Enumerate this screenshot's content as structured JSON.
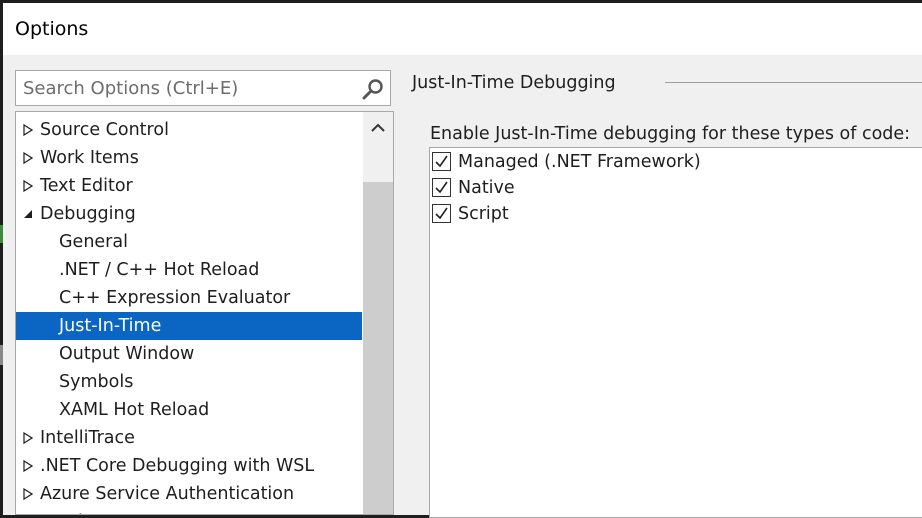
{
  "window": {
    "title": "Options"
  },
  "search": {
    "placeholder": "Search Options (Ctrl+E)"
  },
  "tree": {
    "items": [
      {
        "label": "Source Control",
        "expander": "collapsed",
        "level": 0
      },
      {
        "label": "Work Items",
        "expander": "collapsed",
        "level": 0
      },
      {
        "label": "Text Editor",
        "expander": "collapsed",
        "level": 0
      },
      {
        "label": "Debugging",
        "expander": "expanded",
        "level": 0
      },
      {
        "label": "General",
        "expander": "none",
        "level": 1
      },
      {
        "label": ".NET / C++ Hot Reload",
        "expander": "none",
        "level": 1
      },
      {
        "label": "C++ Expression Evaluator",
        "expander": "none",
        "level": 1
      },
      {
        "label": "Just-In-Time",
        "expander": "none",
        "level": 1,
        "selected": true
      },
      {
        "label": "Output Window",
        "expander": "none",
        "level": 1
      },
      {
        "label": "Symbols",
        "expander": "none",
        "level": 1
      },
      {
        "label": "XAML Hot Reload",
        "expander": "none",
        "level": 1
      },
      {
        "label": "IntelliTrace",
        "expander": "collapsed",
        "level": 0
      },
      {
        "label": ".NET Core Debugging with WSL",
        "expander": "collapsed",
        "level": 0
      },
      {
        "label": "Azure Service Authentication",
        "expander": "collapsed",
        "level": 0
      },
      {
        "label": "CMake",
        "expander": "collapsed",
        "level": 0
      }
    ]
  },
  "panel": {
    "section_title": "Just-In-Time Debugging",
    "prompt": "Enable Just-In-Time debugging for these types of code:",
    "code_types": [
      {
        "label": "Managed (.NET Framework)",
        "checked": true
      },
      {
        "label": "Native",
        "checked": true
      },
      {
        "label": "Script",
        "checked": true
      }
    ]
  },
  "colors": {
    "selection": "#0a66c2",
    "window_bg": "#f0f0f0",
    "title_bg": "#ffffff",
    "border": "#a8a8a8"
  },
  "icons": {
    "search": "search-icon",
    "scroll_up": "chevron-up-icon",
    "collapsed": "triangle-right-icon",
    "expanded": "triangle-down-icon",
    "check": "checkmark-icon"
  }
}
